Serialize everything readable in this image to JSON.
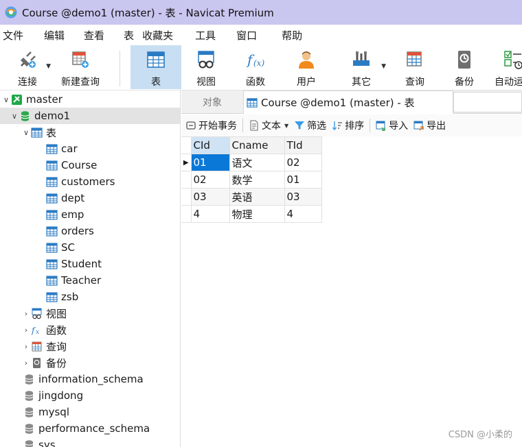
{
  "window": {
    "title": "Course @demo1 (master) - 表 - Navicat Premium"
  },
  "menu": [
    "文件",
    "编辑",
    "查看",
    "表",
    "收藏夹",
    "工具",
    "窗口",
    "帮助"
  ],
  "toolbar": {
    "connect": "连接",
    "new_query": "新建查询",
    "table": "表",
    "view": "视图",
    "function": "函数",
    "user": "用户",
    "other": "其它",
    "query": "查询",
    "backup": "备份",
    "automation": "自动运"
  },
  "tree": {
    "connection": "master",
    "database": "demo1",
    "tables_group": "表",
    "tables": [
      "car",
      "Course",
      "customers",
      "dept",
      "emp",
      "orders",
      "SC",
      "Student",
      "Teacher",
      "zsb"
    ],
    "views_group": "视图",
    "functions_group": "函数",
    "queries_group": "查询",
    "backups_group": "备份",
    "other_databases": [
      "information_schema",
      "jingdong",
      "mysql",
      "performance_schema",
      "sys"
    ]
  },
  "tabs": {
    "objects": "对象",
    "course": "Course @demo1 (master) - 表"
  },
  "grid_toolbar": {
    "begin_transaction": "开始事务",
    "text": "文本",
    "filter": "筛选",
    "sort": "排序",
    "import": "导入",
    "export": "导出"
  },
  "grid": {
    "columns": [
      "CId",
      "Cname",
      "TId"
    ],
    "rows": [
      [
        "01",
        "语文",
        "02"
      ],
      [
        "02",
        "数学",
        "01"
      ],
      [
        "03",
        "英语",
        "03"
      ],
      [
        "4",
        "物理",
        "4"
      ]
    ]
  },
  "watermark": "CSDN @小柔的",
  "colors": {
    "title_bar": "#c9c6f0",
    "selection": "#0a78d7",
    "active_tool": "#c8def2"
  }
}
